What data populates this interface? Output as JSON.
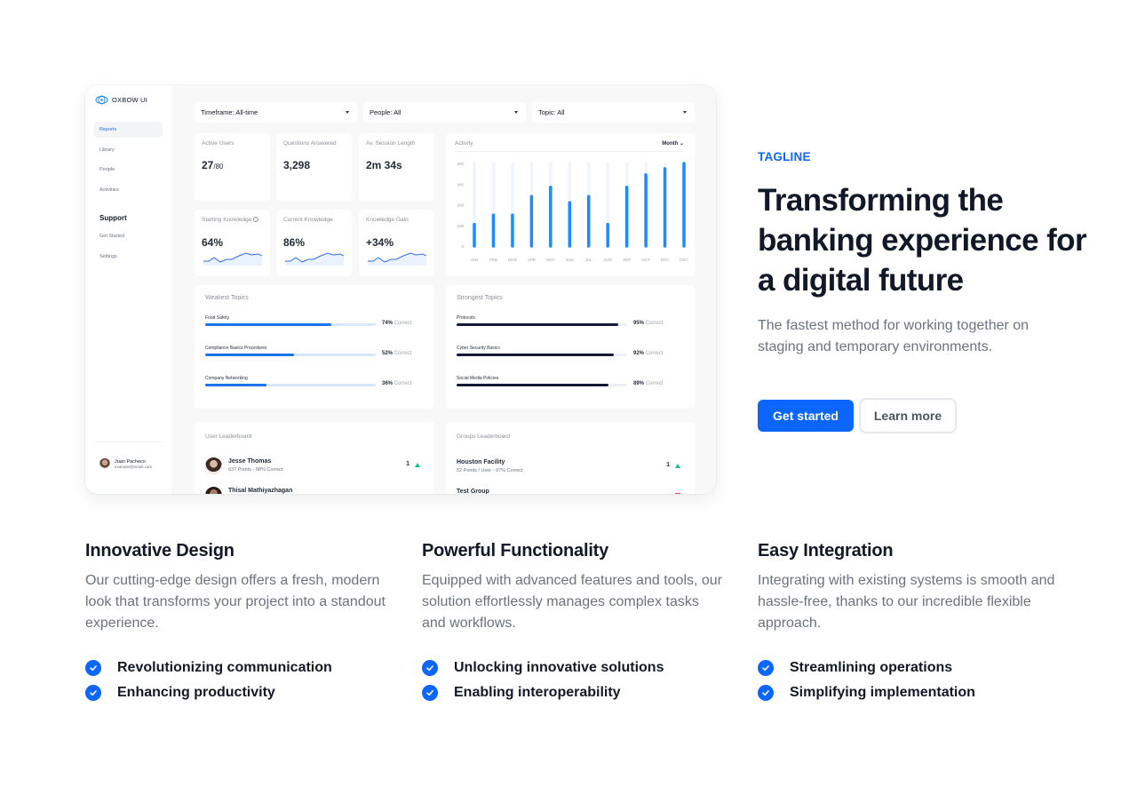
{
  "dashboard": {
    "brand": "OXBOW UI",
    "nav": [
      {
        "label": "Reports",
        "active": true
      },
      {
        "label": "Library",
        "active": false
      },
      {
        "label": "People",
        "active": false
      },
      {
        "label": "Activities",
        "active": false
      }
    ],
    "support_heading": "Support",
    "support_nav": [
      {
        "label": "Get Started"
      },
      {
        "label": "Settings"
      }
    ],
    "user": {
      "name": "Juan Pacheco",
      "email": "example@email.com"
    },
    "filters": [
      {
        "label": "Timeframe: All-time"
      },
      {
        "label": "People: All"
      },
      {
        "label": "Topic: All"
      }
    ],
    "stats": [
      {
        "label": "Active Users",
        "value": "27",
        "suffix": "/80"
      },
      {
        "label": "Questions Answered",
        "value": "3,298"
      },
      {
        "label": "Av. Session Length",
        "value": "2m 34s"
      },
      {
        "label": "Starting Knowledge",
        "value": "64%"
      },
      {
        "label": "Current Knowledge",
        "value": "86%"
      },
      {
        "label": "Knowledge Gain",
        "value": "+34%"
      }
    ],
    "activity": {
      "title": "Activity",
      "period_label": "Month"
    },
    "weakest": {
      "title": "Weakest Topics",
      "correct_label": "Correct",
      "items": [
        {
          "name": "Food Safety",
          "pct": 74,
          "pct_label": "74%"
        },
        {
          "name": "Compliance Basics Procedures",
          "pct": 52,
          "pct_label": "52%"
        },
        {
          "name": "Company Networking",
          "pct": 36,
          "pct_label": "36%"
        }
      ]
    },
    "strongest": {
      "title": "Strongest Topics",
      "correct_label": "Correct",
      "items": [
        {
          "name": "Protocols",
          "pct": 95,
          "pct_label": "95%"
        },
        {
          "name": "Cyber Security Basics",
          "pct": 92,
          "pct_label": "92%"
        },
        {
          "name": "Social Media Policies",
          "pct": 89,
          "pct_label": "89%"
        }
      ]
    },
    "user_leaderboard": {
      "title": "User Leaderboard",
      "rows": [
        {
          "name": "Jesse Thomas",
          "sub": "637 Points - 98% Correct",
          "rank": "1",
          "trend": "up"
        },
        {
          "name": "Thisal Mathiyazhagan",
          "sub": "",
          "rank": "",
          "trend": ""
        }
      ]
    },
    "groups_leaderboard": {
      "title": "Groups Leaderboard",
      "rows": [
        {
          "name": "Houston Facility",
          "sub": "52 Points / User - 97% Correct",
          "rank": "1",
          "trend": "up"
        },
        {
          "name": "Test Group",
          "sub": "",
          "rank": "",
          "trend": "down"
        }
      ]
    }
  },
  "chart_data": {
    "type": "bar",
    "title": "Activity",
    "categories": [
      "JAN",
      "FEB",
      "MAR",
      "APR",
      "MAY",
      "JUN",
      "JUL",
      "AUG",
      "SEP",
      "OCT",
      "NOV",
      "DEC"
    ],
    "values": [
      105,
      150,
      150,
      240,
      285,
      210,
      240,
      105,
      285,
      345,
      375,
      400
    ],
    "yticks": [
      0,
      100,
      200,
      300,
      400
    ],
    "ylim": [
      0,
      400
    ],
    "xlabel": "",
    "ylabel": "",
    "grid": false,
    "color": "#1a8cff",
    "track_color": "#eef5ff"
  },
  "hero": {
    "tagline": "TAGLINE",
    "headline": "Transforming the banking experience for a digital future",
    "subcopy": "The fastest method for working together on staging and temporary environments.",
    "primary_cta": "Get started",
    "secondary_cta": "Learn more",
    "accent": "#0a66ff"
  },
  "features": [
    {
      "title": "Innovative Design",
      "description": "Our cutting-edge design offers a fresh, modern look that transforms your project into a standout experience.",
      "items": [
        "Revolutionizing communication",
        "Enhancing productivity"
      ]
    },
    {
      "title": "Powerful Functionality",
      "description": "Equipped with advanced features and tools, our solution effortlessly manages complex tasks and workflows.",
      "items": [
        "Unlocking innovative solutions",
        "Enabling interoperability"
      ]
    },
    {
      "title": "Easy Integration",
      "description": "Integrating with existing systems is smooth and hassle-free, thanks to our incredible flexible approach.",
      "items": [
        "Streamlining operations",
        "Simplifying implementation"
      ]
    }
  ]
}
